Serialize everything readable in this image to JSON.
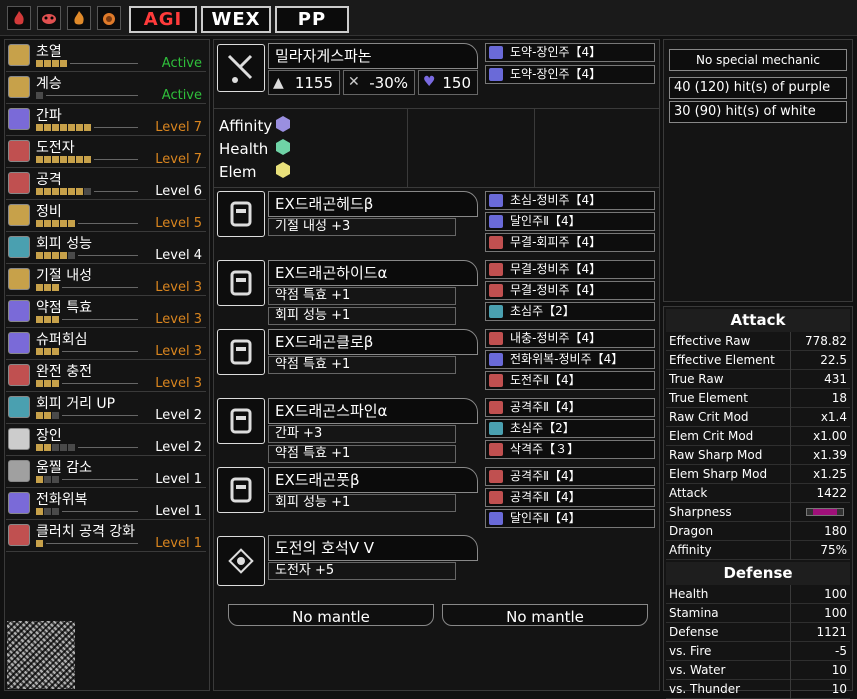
{
  "topbar": {
    "buttons": [
      "AGI",
      "WEX",
      "PP"
    ]
  },
  "skills": [
    {
      "name": "초열",
      "filled": 4,
      "total": 4,
      "level": "Active",
      "color": "green"
    },
    {
      "name": "계승",
      "filled": 0,
      "total": 1,
      "level": "Active",
      "color": "green"
    },
    {
      "name": "간파",
      "filled": 7,
      "total": 7,
      "level": "Level 7",
      "color": "orange"
    },
    {
      "name": "도전자",
      "filled": 7,
      "total": 7,
      "level": "Level 7",
      "color": "orange"
    },
    {
      "name": "공격",
      "filled": 6,
      "total": 7,
      "level": "Level 6",
      "color": "white"
    },
    {
      "name": "정비",
      "filled": 5,
      "total": 5,
      "level": "Level 5",
      "color": "orange"
    },
    {
      "name": "회피 성능",
      "filled": 4,
      "total": 5,
      "level": "Level 4",
      "color": "white"
    },
    {
      "name": "기절 내성",
      "filled": 3,
      "total": 3,
      "level": "Level 3",
      "color": "orange"
    },
    {
      "name": "약점 특효",
      "filled": 3,
      "total": 3,
      "level": "Level 3",
      "color": "orange"
    },
    {
      "name": "슈퍼회심",
      "filled": 3,
      "total": 3,
      "level": "Level 3",
      "color": "orange"
    },
    {
      "name": "완전 충전",
      "filled": 3,
      "total": 3,
      "level": "Level 3",
      "color": "orange"
    },
    {
      "name": "회피 거리 UP",
      "filled": 2,
      "total": 3,
      "level": "Level 2",
      "color": "white"
    },
    {
      "name": "장인",
      "filled": 2,
      "total": 5,
      "level": "Level 2",
      "color": "white"
    },
    {
      "name": "움찔 감소",
      "filled": 1,
      "total": 3,
      "level": "Level 1",
      "color": "white"
    },
    {
      "name": "전화위복",
      "filled": 1,
      "total": 3,
      "level": "Level 1",
      "color": "white"
    },
    {
      "name": "클러치 공격 강화",
      "filled": 1,
      "total": 1,
      "level": "Level 1",
      "color": "orange"
    }
  ],
  "weapon": {
    "name": "밀라자게스파논",
    "attack": "1155",
    "affinity": "-30%",
    "element": "150",
    "decos": [
      "도약-장인주【4】",
      "도약-장인주【4】"
    ]
  },
  "kinsect": {
    "labels": [
      "Affinity",
      "Health",
      "Elem"
    ]
  },
  "armor": [
    {
      "name": "EX드래곤헤드β",
      "icon": "helm-icon",
      "skills": [
        "기절 내성 +3"
      ],
      "decos": [
        "초심-정비주【4】",
        "달인주Ⅱ【4】",
        "무결-회피주【4】"
      ]
    },
    {
      "name": "EX드래곤하이드α",
      "icon": "chest-icon",
      "skills": [
        "약점 특효 +1",
        "회피 성능 +1"
      ],
      "decos": [
        "무결-정비주【4】",
        "무결-정비주【4】",
        "초심주【2】"
      ]
    },
    {
      "name": "EX드래곤클로β",
      "icon": "arms-icon",
      "skills": [
        "약점 특효 +1"
      ],
      "decos": [
        "내충-정비주【4】",
        "전화위복-정비주【4】",
        "도전주Ⅱ【4】"
      ]
    },
    {
      "name": "EX드래곤스파인α",
      "icon": "waist-icon",
      "skills": [
        "간파 +3",
        "약점 특효 +1"
      ],
      "decos": [
        "공격주Ⅱ【4】",
        "초심주【2】",
        "삭격주【３】"
      ]
    },
    {
      "name": "EX드래곤풋β",
      "icon": "legs-icon",
      "skills": [
        "회피 성능 +1"
      ],
      "decos": [
        "공격주Ⅱ【4】",
        "공격주Ⅱ【4】",
        "달인주Ⅱ【4】"
      ]
    }
  ],
  "charm": {
    "name": "도전의 호석Ⅴ Ⅴ",
    "skill": "도전자 +5"
  },
  "mantles": [
    "No mantle",
    "No mantle"
  ],
  "mechanic": {
    "label": "No special mechanic",
    "purple": "40 (120) hit(s) of purple",
    "white": "30 (90) hit(s) of white"
  },
  "attack_stats": {
    "title": "Attack",
    "rows": [
      [
        "Effective Raw",
        "778.82"
      ],
      [
        "Effective Element",
        "22.5"
      ],
      [
        "True Raw",
        "431"
      ],
      [
        "True Element",
        "18"
      ],
      [
        "Raw Crit Mod",
        "x1.4"
      ],
      [
        "Elem Crit Mod",
        "x1.00"
      ],
      [
        "Raw Sharp Mod",
        "x1.39"
      ],
      [
        "Elem Sharp Mod",
        "x1.25"
      ],
      [
        "Attack",
        "1422"
      ],
      [
        "Sharpness",
        ""
      ],
      [
        "Dragon",
        "180"
      ],
      [
        "Affinity",
        "75%"
      ]
    ]
  },
  "defense_stats": {
    "title": "Defense",
    "rows": [
      [
        "Health",
        "100"
      ],
      [
        "Stamina",
        "100"
      ],
      [
        "Defense",
        "1121"
      ],
      [
        "vs. Fire",
        "-5"
      ],
      [
        "vs. Water",
        "10"
      ],
      [
        "vs. Thunder",
        "10"
      ]
    ]
  },
  "colors": {
    "purple": "#9a8fe0",
    "green": "#6fd3a6",
    "yellow": "#e8e07a",
    "sharp": "#a0107a",
    "accent": "#c7a14a"
  }
}
